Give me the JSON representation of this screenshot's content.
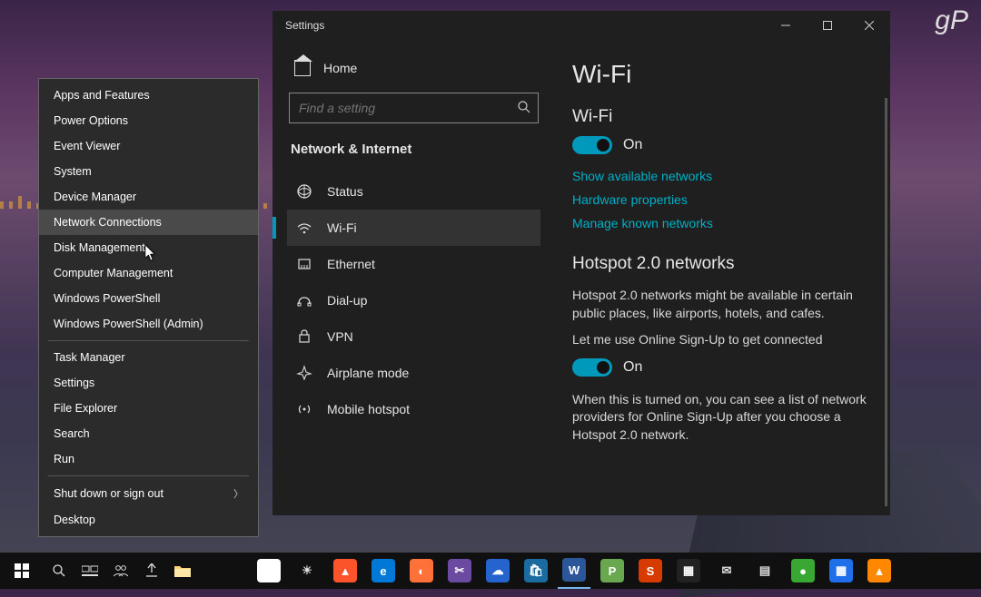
{
  "watermark": "gP",
  "context_menu": {
    "groups": [
      [
        "Apps and Features",
        "Power Options",
        "Event Viewer",
        "System",
        "Device Manager",
        "Network Connections",
        "Disk Management",
        "Computer Management",
        "Windows PowerShell",
        "Windows PowerShell (Admin)"
      ],
      [
        "Task Manager",
        "Settings",
        "File Explorer",
        "Search",
        "Run"
      ],
      [
        "Shut down or sign out",
        "Desktop"
      ]
    ],
    "hover_item": "Network Connections",
    "submenu_arrow_on": "Shut down or sign out"
  },
  "settings": {
    "window_title": "Settings",
    "home_label": "Home",
    "search_placeholder": "Find a setting",
    "section_title": "Network & Internet",
    "nav_items": [
      {
        "icon": "status",
        "label": "Status"
      },
      {
        "icon": "wifi",
        "label": "Wi-Fi",
        "active": true
      },
      {
        "icon": "ethernet",
        "label": "Ethernet"
      },
      {
        "icon": "dialup",
        "label": "Dial-up"
      },
      {
        "icon": "vpn",
        "label": "VPN"
      },
      {
        "icon": "airplane",
        "label": "Airplane mode"
      },
      {
        "icon": "hotspot",
        "label": "Mobile hotspot"
      }
    ],
    "content": {
      "page_title": "Wi-Fi",
      "wifi_section_label": "Wi-Fi",
      "wifi_on_label": "On",
      "links": [
        "Show available networks",
        "Hardware properties",
        "Manage known networks"
      ],
      "hotspot_title": "Hotspot 2.0 networks",
      "hotspot_desc": "Hotspot 2.0 networks might be available in certain public places, like airports, hotels, and cafes.",
      "signup_label": "Let me use Online Sign-Up to get connected",
      "signup_on_label": "On",
      "signup_desc": "When this is turned on, you can see a list of network providers for Online Sign-Up after you choose a Hotspot 2.0 network."
    }
  },
  "taskbar": {
    "apps": [
      {
        "name": "chrome",
        "color": "#fff"
      },
      {
        "name": "brightness",
        "color": "transparent"
      },
      {
        "name": "brave",
        "color": "#fb542b"
      },
      {
        "name": "edge",
        "color": "#0078d7"
      },
      {
        "name": "firefox",
        "color": "#ff7139"
      },
      {
        "name": "snip",
        "color": "#6b4ba1"
      },
      {
        "name": "mstodo",
        "color": "#2564cf"
      },
      {
        "name": "store",
        "color": "#1a6b9f"
      },
      {
        "name": "word",
        "color": "#2b579a",
        "active": true
      },
      {
        "name": "pub",
        "color": "#6aa84f"
      },
      {
        "name": "sway",
        "color": "#d83b01"
      },
      {
        "name": "video",
        "color": "#222"
      },
      {
        "name": "mail",
        "color": "transparent"
      },
      {
        "name": "calendar",
        "color": "transparent"
      },
      {
        "name": "vpn",
        "color": "#38a832"
      },
      {
        "name": "calculator",
        "color": "#1f6feb"
      },
      {
        "name": "vlc",
        "color": "#ff8800"
      }
    ]
  }
}
